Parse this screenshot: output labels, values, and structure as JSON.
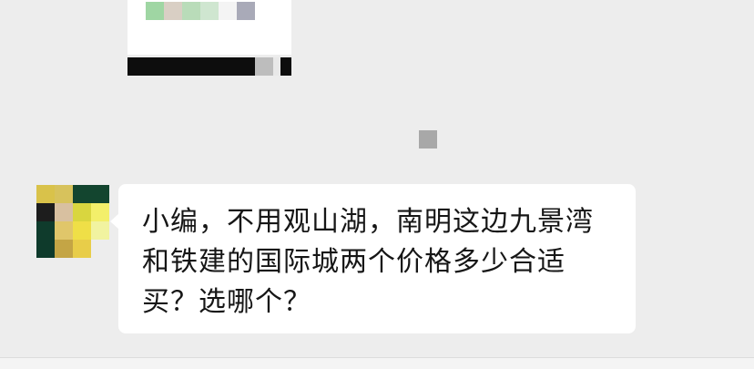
{
  "chat": {
    "messages": [
      {
        "type": "text",
        "direction": "incoming",
        "text": "小编，不用观山湖，南明这边九景湾和铁建的国际城两个价格多少合适买？选哪个？"
      }
    ]
  },
  "colors": {
    "background": "#ededed",
    "bubble": "#ffffff",
    "text": "#161616"
  }
}
